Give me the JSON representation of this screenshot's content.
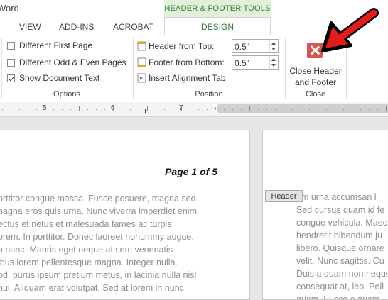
{
  "app": {
    "title": "Word"
  },
  "context_tab": {
    "label": "HEADER & FOOTER TOOLS"
  },
  "tabs": [
    {
      "label": "VIEW"
    },
    {
      "label": "ADD-INS"
    },
    {
      "label": "ACROBAT"
    },
    {
      "label": "DESIGN",
      "active": true
    }
  ],
  "ribbon": {
    "options": {
      "label": "Options",
      "items": [
        {
          "label": "Different First Page",
          "checked": false
        },
        {
          "label": "Different Odd & Even Pages",
          "checked": false
        },
        {
          "label": "Show Document Text",
          "checked": true
        }
      ]
    },
    "position": {
      "label": "Position",
      "header_from_top_label": "Header from Top:",
      "header_from_top_value": "0.5\"",
      "footer_from_bottom_label": "Footer from Bottom:",
      "footer_from_bottom_value": "0.5\"",
      "insert_alignment_tab": "Insert Alignment Tab"
    },
    "close": {
      "label": "Close",
      "button_line1": "Close Header",
      "button_line2": "and Footer"
    }
  },
  "ruler": {
    "numbers": [
      "5",
      "6",
      "7"
    ]
  },
  "document": {
    "page_number_text": "Page 1 of 5",
    "header_tag": "Header",
    "left_page_lines": [
      "orttitor congue massa. Fusce posuere, magna sed",
      "nagna eros quis urna. Nunc viverra imperdiet enim.",
      "ectus et netus et malesuada fames ac turpis",
      "orem. In porttitor. Donec laoreet nonummy augue.",
      "a nunc. Mauris eget neque at sem venenatis",
      "ibus lorem pellentesque magna. Integer nulla.",
      "od, purus ipsum pretium metus, in lacinia nulla nisl",
      "nui. Aliquam erat volutpat. Sed at lorem in nunc"
    ],
    "right_page_lines": [
      "am urna accumsan l",
      "Sed cursus quam id fe",
      "congue vehicula. Maec",
      "hendrerit bibendum ju",
      "libero. Quisque ornare",
      "velit. Nunc sagittis. Cu",
      "Duis a quam non neque",
      "consequat at, leo. Pell",
      "quam. Fusce a quam."
    ]
  },
  "colors": {
    "accent_green": "#2e7d32",
    "context_band": "#e2f0d9",
    "close_red": "#d9534f"
  }
}
